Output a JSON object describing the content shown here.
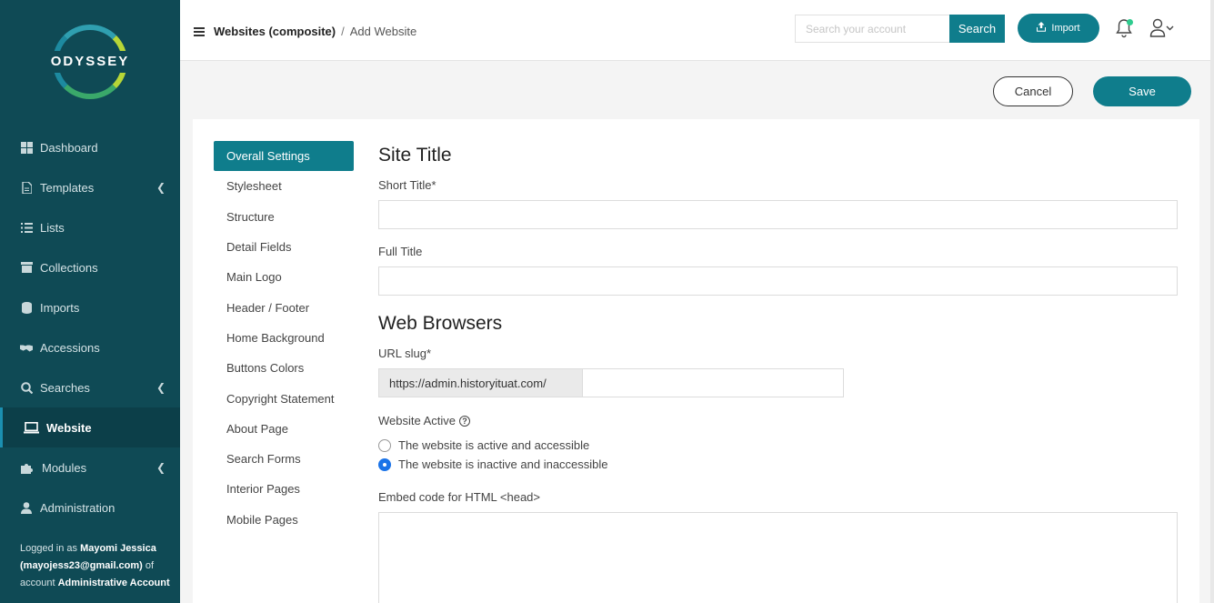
{
  "brand": {
    "logo_text": "ODYSSEY"
  },
  "sidebar": {
    "items": [
      {
        "label": "Dashboard",
        "icon": "dashboard-icon",
        "has_chevron": false
      },
      {
        "label": "Templates",
        "icon": "file-icon",
        "has_chevron": true
      },
      {
        "label": "Lists",
        "icon": "list-icon",
        "has_chevron": false
      },
      {
        "label": "Collections",
        "icon": "archive-icon",
        "has_chevron": false
      },
      {
        "label": "Imports",
        "icon": "database-icon",
        "has_chevron": false
      },
      {
        "label": "Accessions",
        "icon": "handshake-icon",
        "has_chevron": false
      },
      {
        "label": "Searches",
        "icon": "search-icon",
        "has_chevron": true
      },
      {
        "label": "Website",
        "icon": "laptop-icon",
        "has_chevron": false,
        "active": true
      },
      {
        "label": "Modules",
        "icon": "puzzle-icon",
        "has_chevron": true
      },
      {
        "label": "Administration",
        "icon": "user-icon",
        "has_chevron": false
      }
    ],
    "logged_in": {
      "prefix": "Logged in as",
      "name": "Mayomi Jessica",
      "email": "(mayojess23@gmail.com)",
      "of_text": "of",
      "account_label": "account",
      "account_name": "Administrative Account"
    }
  },
  "header": {
    "breadcrumb_parent": "Websites (composite)",
    "breadcrumb_sep": "/",
    "breadcrumb_current": "Add Website",
    "search_placeholder": "Search your account",
    "search_button": "Search",
    "import_button": "Import"
  },
  "actions": {
    "cancel": "Cancel",
    "save": "Save"
  },
  "settings_nav": [
    "Overall Settings",
    "Stylesheet",
    "Structure",
    "Detail Fields",
    "Main Logo",
    "Header / Footer",
    "Home Background",
    "Buttons Colors",
    "Copyright Statement",
    "About Page",
    "Search Forms",
    "Interior Pages",
    "Mobile Pages"
  ],
  "form": {
    "site_title_heading": "Site Title",
    "short_title_label": "Short Title*",
    "short_title_value": "",
    "full_title_label": "Full Title",
    "full_title_value": "",
    "web_browsers_heading": "Web Browsers",
    "url_slug_label": "URL slug*",
    "url_prefix": "https://admin.historyituat.com/",
    "url_slug_value": "",
    "website_active_label": "Website Active",
    "help_symbol": "?",
    "radio_active": "The website is active and accessible",
    "radio_inactive": "The website is inactive and inaccessible",
    "selected": "inactive",
    "embed_label": "Embed code for HTML <head>",
    "embed_value": ""
  },
  "colors": {
    "sidebar_bg": "#0f4a55",
    "accent": "#0f7d8c",
    "radio_selected": "#1a73e8"
  }
}
